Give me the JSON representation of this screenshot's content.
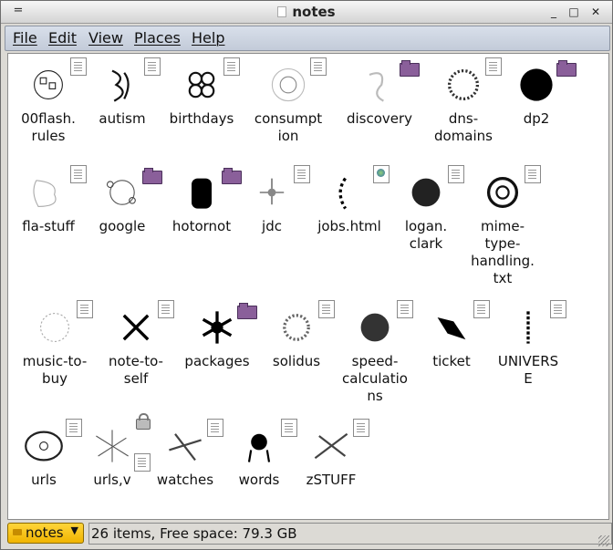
{
  "window": {
    "title": "notes"
  },
  "titlebar": {
    "menu_glyph": "=",
    "minimize_glyph": "_",
    "maximize_glyph": "□",
    "close_glyph": "✕"
  },
  "menubar": [
    "File",
    "Edit",
    "View",
    "Places",
    "Help"
  ],
  "files": [
    {
      "name": "00flash.\nrules",
      "icon": "doc-thumb-icon"
    },
    {
      "name": "autism",
      "icon": "doc-thumb-icon"
    },
    {
      "name": "birthdays",
      "icon": "doc-thumb-icon"
    },
    {
      "name": "consumpt\nion",
      "icon": "doc-thumb-icon"
    },
    {
      "name": "discovery",
      "icon": "folder-thumb-icon"
    },
    {
      "name": "dns-\ndomains",
      "icon": "doc-thumb-icon"
    },
    {
      "name": "dp2",
      "icon": "folder-thumb-icon"
    },
    {
      "name": "fla-stuff",
      "icon": "doc-thumb-icon"
    },
    {
      "name": "google",
      "icon": "folder-thumb-icon"
    },
    {
      "name": "hotornot",
      "icon": "folder-thumb-icon"
    },
    {
      "name": "jdc",
      "icon": "doc-thumb-icon"
    },
    {
      "name": "jobs.html",
      "icon": "html-thumb-icon"
    },
    {
      "name": "logan.\nclark",
      "icon": "doc-thumb-icon"
    },
    {
      "name": "mime-\ntype-\nhandling.\ntxt",
      "icon": "doc-thumb-icon"
    },
    {
      "name": "music-to-\nbuy",
      "icon": "doc-thumb-icon"
    },
    {
      "name": "note-to-\nself",
      "icon": "doc-thumb-icon"
    },
    {
      "name": "packages",
      "icon": "folder-thumb-icon"
    },
    {
      "name": "solidus",
      "icon": "doc-thumb-icon"
    },
    {
      "name": "speed-\ncalculatio\nns",
      "icon": "doc-thumb-icon"
    },
    {
      "name": "ticket",
      "icon": "doc-thumb-icon"
    },
    {
      "name": "UNIVERS\nE",
      "icon": "doc-thumb-icon"
    },
    {
      "name": "urls",
      "icon": "doc-thumb-icon"
    },
    {
      "name": "urls,v",
      "icon": "locked-doc-thumb-icon"
    },
    {
      "name": "watches",
      "icon": "doc-thumb-icon"
    },
    {
      "name": "words",
      "icon": "doc-thumb-icon"
    },
    {
      "name": "zSTUFF",
      "icon": "doc-thumb-icon"
    }
  ],
  "status": {
    "location": "notes",
    "text": "26 items, Free space: 79.3 GB"
  }
}
